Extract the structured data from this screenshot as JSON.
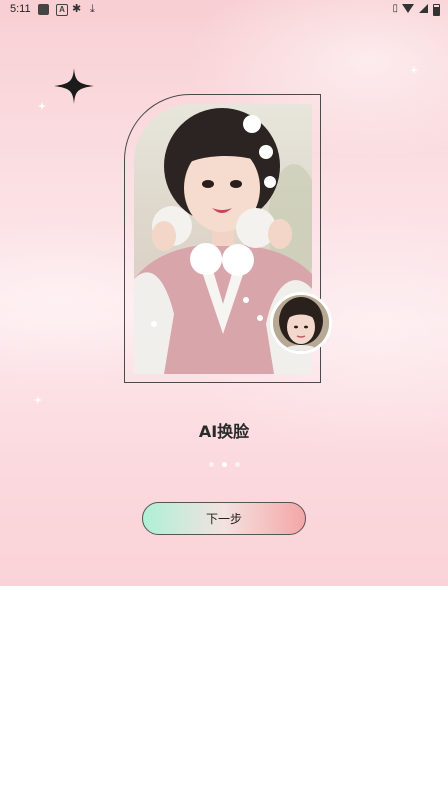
{
  "status_bar": {
    "time": "5:11",
    "icons": [
      "app-square-icon",
      "a-notification-icon",
      "bug-icon",
      "download-icon",
      "vibrate-icon",
      "wifi-icon",
      "signal-icon",
      "battery-icon"
    ]
  },
  "onboarding": {
    "title": "AI换脸",
    "page_indicator": {
      "total": 3,
      "current_index": 1
    },
    "next_button_label": "下一步"
  },
  "colors": {
    "button_gradient_start": "#aef0d6",
    "button_gradient_end": "#f4a6a6",
    "background_pink": "#fbdfe3"
  },
  "images": {
    "main_photo": "woman-in-hanfu-photo",
    "face_thumbnail": "face-avatar-photo"
  }
}
